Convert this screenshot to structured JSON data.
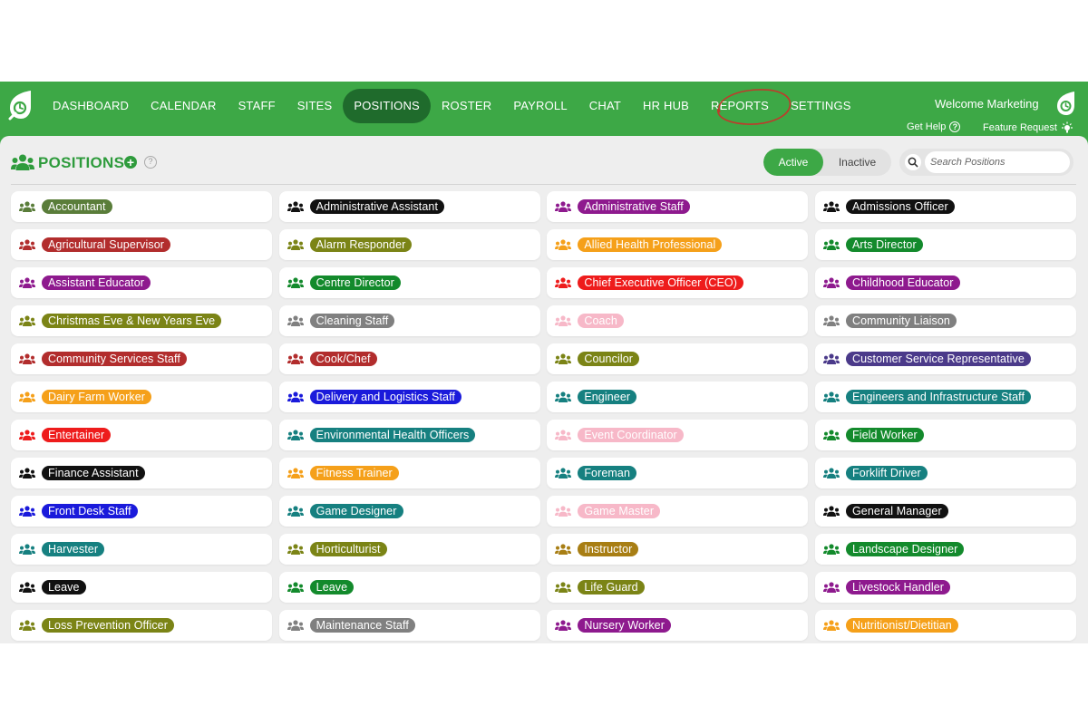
{
  "app": {
    "brand_color": "#3da846"
  },
  "nav": {
    "items": [
      {
        "label": "DASHBOARD"
      },
      {
        "label": "CALENDAR"
      },
      {
        "label": "STAFF"
      },
      {
        "label": "SITES"
      },
      {
        "label": "POSITIONS",
        "active": true
      },
      {
        "label": "ROSTER"
      },
      {
        "label": "PAYROLL"
      },
      {
        "label": "CHAT"
      },
      {
        "label": "HR HUB"
      },
      {
        "label": "REPORTS"
      },
      {
        "label": "SETTINGS",
        "annotated": true
      }
    ],
    "annotation_color": "#c0392b"
  },
  "user": {
    "welcome": "Welcome Marketing",
    "get_help": "Get Help",
    "feature_request": "Feature Request"
  },
  "page": {
    "title": "POSITIONS",
    "title_color": "#2e9b3c",
    "toggle": {
      "active": "Active",
      "inactive": "Inactive",
      "selected": "Active"
    },
    "search": {
      "placeholder": "Search Positions",
      "value": ""
    }
  },
  "positions": [
    {
      "label": "Accountant",
      "color": "#5a7d3a"
    },
    {
      "label": "Administrative Assistant",
      "color": "#111111"
    },
    {
      "label": "Administrative Staff",
      "color": "#8e1a8e"
    },
    {
      "label": "Admissions Officer",
      "color": "#111111"
    },
    {
      "label": "Agricultural Supervisor",
      "color": "#b22d2d"
    },
    {
      "label": "Alarm Responder",
      "color": "#7b8416"
    },
    {
      "label": "Allied Health Professional",
      "color": "#f5a01a"
    },
    {
      "label": "Arts Director",
      "color": "#138a2c"
    },
    {
      "label": "Assistant Educator",
      "color": "#8e1a8e"
    },
    {
      "label": "Centre Director",
      "color": "#138a2c"
    },
    {
      "label": "Chief Executive Officer (CEO)",
      "color": "#ee1c1c"
    },
    {
      "label": "Childhood Educator",
      "color": "#8e1a8e"
    },
    {
      "label": "Christmas Eve & New Years Eve",
      "color": "#7b8416"
    },
    {
      "label": "Cleaning Staff",
      "color": "#808080"
    },
    {
      "label": "Coach",
      "color": "#f7b8c8"
    },
    {
      "label": "Community Liaison",
      "color": "#808080"
    },
    {
      "label": "Community Services Staff",
      "color": "#b22d2d"
    },
    {
      "label": "Cook/Chef",
      "color": "#b22d2d"
    },
    {
      "label": "Councilor",
      "color": "#7b8416"
    },
    {
      "label": "Customer Service Representative",
      "color": "#4b3a8a"
    },
    {
      "label": "Dairy Farm Worker",
      "color": "#f5a01a"
    },
    {
      "label": "Delivery and Logistics Staff",
      "color": "#1a1adb"
    },
    {
      "label": "Engineer",
      "color": "#168080"
    },
    {
      "label": "Engineers and Infrastructure Staff",
      "color": "#168080"
    },
    {
      "label": "Entertainer",
      "color": "#ee1c1c"
    },
    {
      "label": "Environmental Health Officers",
      "color": "#168080"
    },
    {
      "label": "Event Coordinator",
      "color": "#f7b8c8"
    },
    {
      "label": "Field Worker",
      "color": "#138a2c"
    },
    {
      "label": "Finance Assistant",
      "color": "#111111"
    },
    {
      "label": "Fitness Trainer",
      "color": "#f5a01a"
    },
    {
      "label": "Foreman",
      "color": "#168080"
    },
    {
      "label": "Forklift Driver",
      "color": "#168080"
    },
    {
      "label": "Front Desk Staff",
      "color": "#1a1adb"
    },
    {
      "label": "Game Designer",
      "color": "#168080"
    },
    {
      "label": "Game Master",
      "color": "#f7b8c8"
    },
    {
      "label": "General Manager",
      "color": "#111111"
    },
    {
      "label": "Harvester",
      "color": "#168080"
    },
    {
      "label": "Horticulturist",
      "color": "#7b8416"
    },
    {
      "label": "Instructor",
      "color": "#a87e14"
    },
    {
      "label": "Landscape Designer",
      "color": "#138a2c"
    },
    {
      "label": "Leave",
      "color": "#111111"
    },
    {
      "label": "Leave",
      "color": "#138a2c"
    },
    {
      "label": "Life Guard",
      "color": "#7b8416"
    },
    {
      "label": "Livestock Handler",
      "color": "#8e1a8e"
    },
    {
      "label": "Loss Prevention Officer",
      "color": "#7b8416"
    },
    {
      "label": "Maintenance Staff",
      "color": "#808080"
    },
    {
      "label": "Nursery Worker",
      "color": "#8e1a8e"
    },
    {
      "label": "Nutritionist/Dietitian",
      "color": "#f5a01a"
    }
  ]
}
